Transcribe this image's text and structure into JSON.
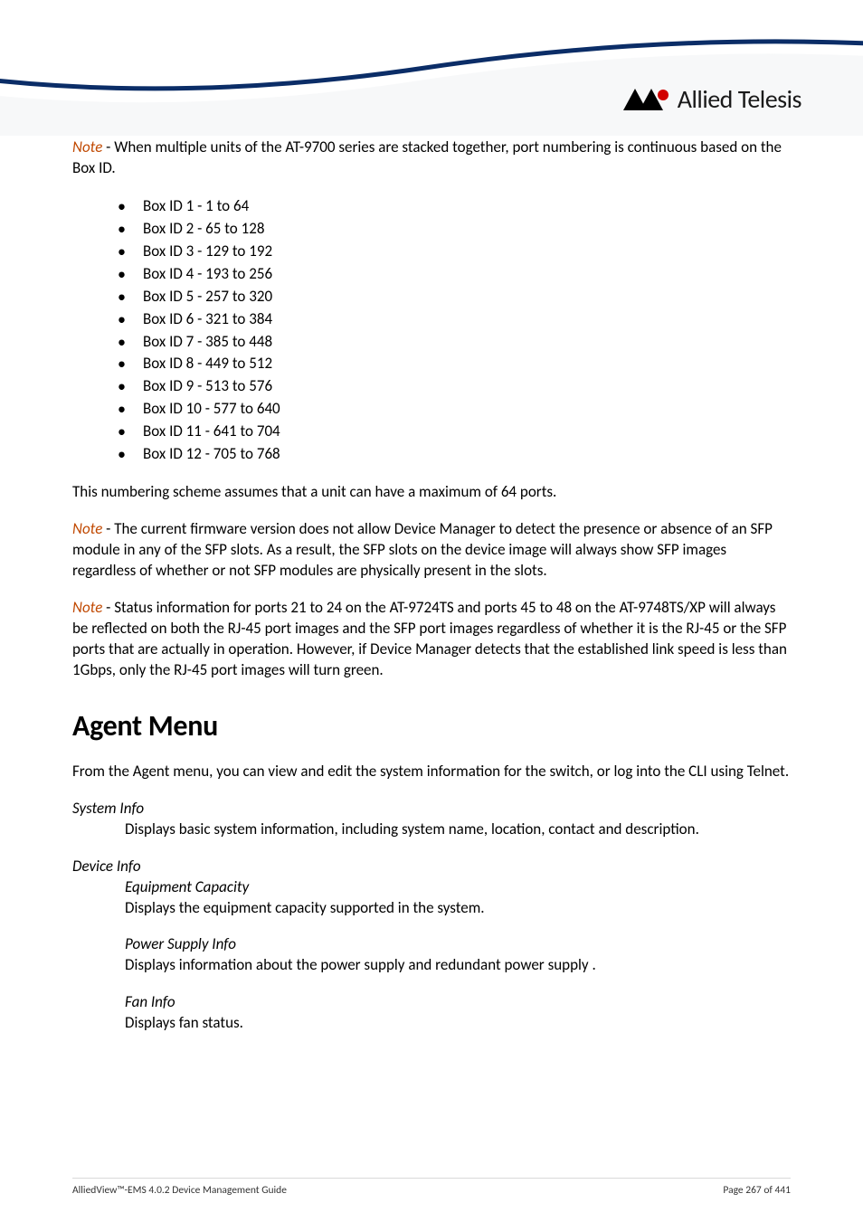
{
  "logo": {
    "brand": "Allied Telesis"
  },
  "body": {
    "p1_note": "Note",
    "p1_rest": " - When multiple units of the AT-9700 series are stacked together, port numbering is continuous based on the Box ID.",
    "box_ids": [
      "Box ID 1 - 1 to 64",
      "Box ID 2 - 65 to 128",
      "Box ID 3 - 129 to 192",
      "Box ID 4 - 193 to 256",
      "Box ID 5 - 257 to 320",
      "Box ID 6 - 321 to 384",
      "Box ID 7 - 385 to 448",
      "Box ID 8 - 449 to 512",
      "Box ID 9 - 513 to 576",
      "Box ID 10 - 577 to 640",
      "Box ID 11 - 641 to 704",
      "Box ID 12 - 705 to 768"
    ],
    "p2": "This numbering scheme assumes that a unit can have a maximum of 64 ports.",
    "p3_note": "Note",
    "p3_rest": " - The current firmware version does not allow Device Manager to detect the presence or absence of an SFP module in any of the SFP slots. As a result, the SFP slots on the device image will always show SFP images regardless of whether or not SFP modules are physically present in the slots.",
    "p4_note": "Note",
    "p4_rest": " - Status information for ports 21 to 24 on the AT-9724TS and ports 45 to 48 on the AT-9748TS/XP will always be reflected on both the RJ-45 port images and the SFP port images regardless of whether it is the RJ-45 or the SFP ports that are actually in operation. However, if Device Manager detects that the established link speed is less than 1Gbps, only the RJ-45 port images will turn green.",
    "agent_menu_heading": "Agent Menu",
    "agent_menu_intro": "From the Agent menu, you can view and edit the system information for the switch, or log into the CLI using Telnet.",
    "system_info_term": "System Info",
    "system_info_desc": "Displays basic system information, including system name, location, contact and description.",
    "device_info_term": "Device Info",
    "equipment_capacity_term": "Equipment Capacity",
    "equipment_capacity_desc": "Displays the equipment capacity supported in the system.",
    "power_supply_term": "Power Supply Info",
    "power_supply_desc": "Displays information about the power supply and redundant power supply .",
    "fan_info_term": "Fan Info",
    "fan_info_desc": "Displays fan status."
  },
  "footer": {
    "left": "AlliedView™-EMS 4.0.2 Device Management Guide",
    "right": "Page 267 of 441"
  }
}
